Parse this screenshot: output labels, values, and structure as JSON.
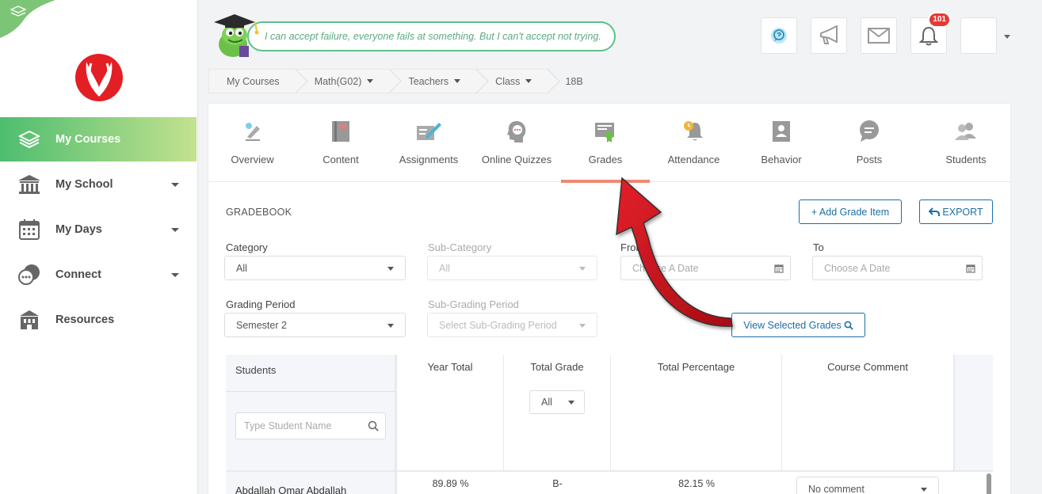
{
  "quote": "I can accept failure, everyone fails at something. But I can't accept not trying.",
  "sidebar": {
    "items": [
      {
        "label": "My Courses",
        "icon": "layers-icon",
        "active": true
      },
      {
        "label": "My School",
        "icon": "school-icon",
        "dropdown": true
      },
      {
        "label": "My Days",
        "icon": "calendar-icon",
        "dropdown": true
      },
      {
        "label": "Connect",
        "icon": "chat-bubbles-icon",
        "dropdown": true
      },
      {
        "label": "Resources",
        "icon": "building-icon"
      }
    ]
  },
  "header": {
    "notification_count": "101"
  },
  "breadcrumb": {
    "items": [
      "My Courses",
      "Math(G02)",
      "Teachers",
      "Class"
    ],
    "current": "18B"
  },
  "tabs": [
    {
      "label": "Overview"
    },
    {
      "label": "Content"
    },
    {
      "label": "Assignments"
    },
    {
      "label": "Online Quizzes"
    },
    {
      "label": "Grades",
      "active": true
    },
    {
      "label": "Attendance"
    },
    {
      "label": "Behavior"
    },
    {
      "label": "Posts"
    },
    {
      "label": "Students"
    }
  ],
  "gradebook": {
    "title": "GRADEBOOK",
    "add_grade_item": "+ Add Grade Item",
    "export": "EXPORT",
    "filters": {
      "category_label": "Category",
      "category_value": "All",
      "subcategory_label": "Sub-Category",
      "subcategory_value": "All",
      "from_label": "From",
      "from_placeholder": "Choose A Date",
      "to_label": "To",
      "to_placeholder": "Choose A Date",
      "grading_period_label": "Grading Period",
      "grading_period_value": "Semester 2",
      "subgrading_label": "Sub-Grading Period",
      "subgrading_placeholder": "Select Sub-Grading Period"
    },
    "view_selected": "View Selected Grades"
  },
  "table": {
    "headers": {
      "students": "Students",
      "year_total": "Year Total",
      "total_grade": "Total Grade",
      "total_percentage": "Total Percentage",
      "course_comment": "Course Comment"
    },
    "grade_filter": "All",
    "search_placeholder": "Type Student Name",
    "rows": [
      {
        "name": "Abdallah Omar Abdallah",
        "year_total": "89.89 %",
        "grade": "B-",
        "percentage": "82.15 %",
        "comment": "No comment"
      }
    ]
  },
  "colors": {
    "accent_green": "#4ebd6f",
    "link_blue": "#1a6fa8",
    "tab_underline": "#ef8a74",
    "arrow_red": "#d0021b"
  }
}
